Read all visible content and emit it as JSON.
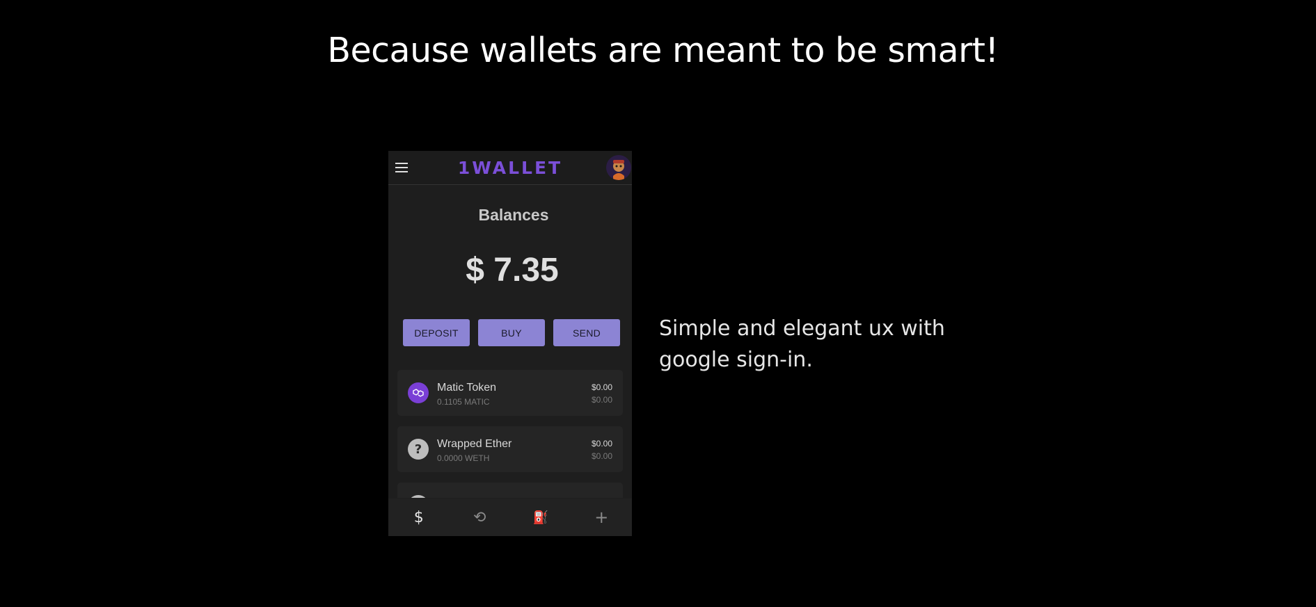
{
  "headline": "Because wallets are meant to be smart!",
  "tagline": "Simple and elegant ux with google sign-in.",
  "app": {
    "logo": "1WALLET",
    "menu_icon": "hamburger-menu-icon",
    "avatar_icon": "profile-avatar",
    "balances_title": "Balances",
    "total_balance": "$ 7.35",
    "actions": {
      "deposit": "DEPOSIT",
      "buy": "BUY",
      "send": "SEND"
    },
    "tokens": [
      {
        "name": "Matic Token",
        "amount": "0.1105 MATIC",
        "value": "$0.00",
        "value_sub": "$0.00",
        "icon": "polygon-icon",
        "icon_color": "#7a3fd6"
      },
      {
        "name": "Wrapped Ether",
        "amount": "0.0000 WETH",
        "value": "$0.00",
        "value_sub": "$0.00",
        "icon": "question-icon",
        "icon_color": "#bdbdbd"
      }
    ],
    "bottom_nav": [
      {
        "icon": "dollar-icon",
        "glyph": "$",
        "active": true
      },
      {
        "icon": "history-icon",
        "glyph": "⟲",
        "active": false
      },
      {
        "icon": "gas-pump-icon",
        "glyph": "⛽",
        "active": false
      },
      {
        "icon": "plus-icon",
        "glyph": "+",
        "active": false
      }
    ]
  },
  "colors": {
    "background": "#000000",
    "accent": "#8c84d4",
    "logo": "#7b4fd8",
    "card": "#252525"
  }
}
